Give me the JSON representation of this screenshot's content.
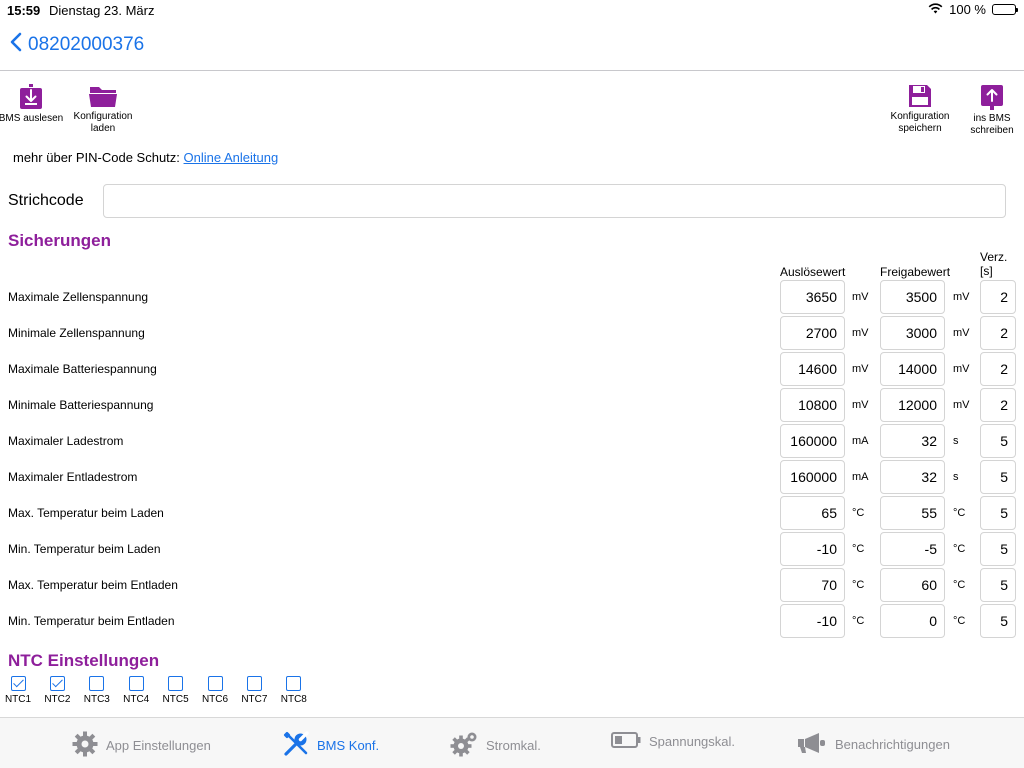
{
  "status": {
    "time": "15:59",
    "date": "Dienstag 23. März",
    "battery": "100 %"
  },
  "nav": {
    "title": "08202000376"
  },
  "toolbar": {
    "read_bms": "BMS auslesen",
    "load_config": "Konfiguration laden",
    "save_config": "Konfiguration speichern",
    "write_bms": "ins BMS schreiben"
  },
  "pin": {
    "text": "mehr über PIN-Code Schutz:",
    "link": "Online Anleitung"
  },
  "barcode": {
    "label": "Strichcode",
    "value": ""
  },
  "protections": {
    "title": "Sicherungen",
    "headers": {
      "trigger": "Auslösewert",
      "release": "Freigabewert",
      "delay": "Verz. [s]"
    },
    "rows": [
      {
        "label": "Maximale Zellenspannung",
        "trigger": "3650",
        "unit1": "mV",
        "release": "3500",
        "unit2": "mV",
        "delay": "2"
      },
      {
        "label": "Minimale Zellenspannung",
        "trigger": "2700",
        "unit1": "mV",
        "release": "3000",
        "unit2": "mV",
        "delay": "2"
      },
      {
        "label": "Maximale Batteriespannung",
        "trigger": "14600",
        "unit1": "mV",
        "release": "14000",
        "unit2": "mV",
        "delay": "2"
      },
      {
        "label": "Minimale Batteriespannung",
        "trigger": "10800",
        "unit1": "mV",
        "release": "12000",
        "unit2": "mV",
        "delay": "2"
      },
      {
        "label": "Maximaler Ladestrom",
        "trigger": "160000",
        "unit1": "mA",
        "release": "32",
        "unit2": "s",
        "delay": "5"
      },
      {
        "label": "Maximaler Entladestrom",
        "trigger": "160000",
        "unit1": "mA",
        "release": "32",
        "unit2": "s",
        "delay": "5"
      },
      {
        "label": "Max. Temperatur beim Laden",
        "trigger": "65",
        "unit1": "°C",
        "release": "55",
        "unit2": "°C",
        "delay": "5"
      },
      {
        "label": "Min. Temperatur beim Laden",
        "trigger": "-10",
        "unit1": "°C",
        "release": "-5",
        "unit2": "°C",
        "delay": "5"
      },
      {
        "label": "Max. Temperatur beim Entladen",
        "trigger": "70",
        "unit1": "°C",
        "release": "60",
        "unit2": "°C",
        "delay": "5"
      },
      {
        "label": "Min. Temperatur beim Entladen",
        "trigger": "-10",
        "unit1": "°C",
        "release": "0",
        "unit2": "°C",
        "delay": "5"
      }
    ]
  },
  "ntc": {
    "title": "NTC Einstellungen",
    "items": [
      {
        "label": "NTC1",
        "checked": true
      },
      {
        "label": "NTC2",
        "checked": true
      },
      {
        "label": "NTC3",
        "checked": false
      },
      {
        "label": "NTC4",
        "checked": false
      },
      {
        "label": "NTC5",
        "checked": false
      },
      {
        "label": "NTC6",
        "checked": false
      },
      {
        "label": "NTC7",
        "checked": false
      },
      {
        "label": "NTC8",
        "checked": false
      }
    ]
  },
  "tabs": {
    "app_settings": "App Einstellungen",
    "bms_config": "BMS Konf.",
    "current_cal": "Stromkal.",
    "voltage_cal": "Spannungskal.",
    "notifications": "Benachrichtigungen"
  },
  "colors": {
    "accent": "#1a73e8",
    "section": "#8e1f9b",
    "tool_icon": "#8e1f9b"
  }
}
